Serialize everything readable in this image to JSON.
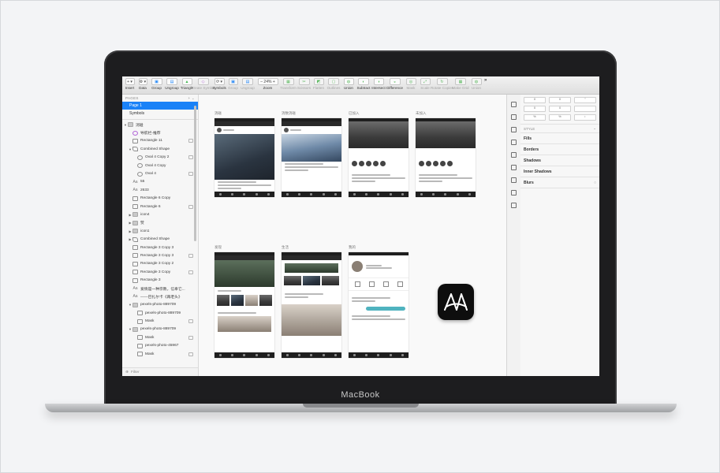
{
  "device": {
    "brand": "MacBook"
  },
  "toolbar": {
    "items": [
      {
        "label": "Insert",
        "glyph": "+ ▾",
        "enabled": true
      },
      {
        "label": "Data",
        "glyph": "⚙ ▾",
        "enabled": true
      },
      {
        "label": "Group",
        "glyph": "▣",
        "enabled": true
      },
      {
        "label": "Ungroup",
        "glyph": "▤",
        "enabled": true
      },
      {
        "label": "Triangle",
        "glyph": "▲",
        "enabled": true
      },
      {
        "label": "Create Symbol",
        "glyph": "◇",
        "enabled": false
      },
      {
        "label": "Symbols",
        "glyph": "⟳ ▾",
        "enabled": true
      },
      {
        "label": "Group",
        "glyph": "▣",
        "enabled": false
      },
      {
        "label": "Ungroup",
        "glyph": "▤",
        "enabled": false
      },
      {
        "label": "Zoom",
        "glyph": "– 24% +",
        "enabled": true
      },
      {
        "label": "Transform",
        "glyph": "▦",
        "enabled": false
      },
      {
        "label": "Scissors",
        "glyph": "✂",
        "enabled": false
      },
      {
        "label": "Flatten",
        "glyph": "◩",
        "enabled": false
      },
      {
        "label": "Outlines",
        "glyph": "▢",
        "enabled": false
      },
      {
        "label": "Union",
        "glyph": "◍",
        "enabled": true
      },
      {
        "label": "Subtract",
        "glyph": "◐",
        "enabled": true
      },
      {
        "label": "Intersect",
        "glyph": "◑",
        "enabled": true
      },
      {
        "label": "Difference",
        "glyph": "◒",
        "enabled": true
      },
      {
        "label": "Mask",
        "glyph": "◎",
        "enabled": false
      },
      {
        "label": "Scale",
        "glyph": "⤢",
        "enabled": false
      },
      {
        "label": "Rotate Copies",
        "glyph": "↻",
        "enabled": false
      },
      {
        "label": "Make Grid",
        "glyph": "▦",
        "enabled": false
      },
      {
        "label": "Union",
        "glyph": "◍",
        "enabled": false
      }
    ],
    "overflow": "»"
  },
  "sidebar": {
    "pages_header": "PAGES",
    "pages_add": "+ ⌄",
    "pages": [
      "Page 1",
      "Symbols"
    ],
    "layers": [
      {
        "name": "消碰",
        "indent": 0,
        "arrow": "▼",
        "type": "folder"
      },
      {
        "name": "导航栏-推荐",
        "indent": 1,
        "arrow": "",
        "type": "symbol"
      },
      {
        "name": "Rectangle 11",
        "indent": 1,
        "arrow": "",
        "type": "rect"
      },
      {
        "name": "Combined Shape",
        "indent": 1,
        "arrow": "▼",
        "type": "shape"
      },
      {
        "name": "Oval 4 Copy 2",
        "indent": 2,
        "arrow": "",
        "type": "oval"
      },
      {
        "name": "Oval 4 Copy",
        "indent": 2,
        "arrow": "",
        "type": "oval"
      },
      {
        "name": "Oval 4",
        "indent": 2,
        "arrow": "",
        "type": "oval"
      },
      {
        "name": "55",
        "indent": 1,
        "arrow": "",
        "type": "text"
      },
      {
        "name": "2633",
        "indent": 1,
        "arrow": "",
        "type": "text"
      },
      {
        "name": "Rectangle 6 Copy",
        "indent": 1,
        "arrow": "",
        "type": "rect"
      },
      {
        "name": "Rectangle 6",
        "indent": 1,
        "arrow": "",
        "type": "rect"
      },
      {
        "name": "icon4",
        "indent": 1,
        "arrow": "▶",
        "type": "folder"
      },
      {
        "name": "赞",
        "indent": 1,
        "arrow": "▶",
        "type": "folder"
      },
      {
        "name": "icon1",
        "indent": 1,
        "arrow": "▶",
        "type": "folder"
      },
      {
        "name": "Combined Shape",
        "indent": 1,
        "arrow": "▶",
        "type": "shape"
      },
      {
        "name": "Rectangle 3 Copy 3",
        "indent": 1,
        "arrow": "",
        "type": "rect"
      },
      {
        "name": "Rectangle 3 Copy 3",
        "indent": 1,
        "arrow": "",
        "type": "rect"
      },
      {
        "name": "Rectangle 3 Copy 2",
        "indent": 1,
        "arrow": "",
        "type": "rect"
      },
      {
        "name": "Rectangle 3 Copy",
        "indent": 1,
        "arrow": "",
        "type": "rect"
      },
      {
        "name": "Rectangle 3",
        "indent": 1,
        "arrow": "",
        "type": "rect"
      },
      {
        "name": "爱情是一种宗教，信奉它...",
        "indent": 1,
        "arrow": "",
        "type": "text"
      },
      {
        "name": "——巴扎尔卡《再老头》",
        "indent": 1,
        "arrow": "",
        "type": "text"
      },
      {
        "name": "pexels-photo-889709",
        "indent": 1,
        "arrow": "▼",
        "type": "folder"
      },
      {
        "name": "pexels-photo-889709",
        "indent": 2,
        "arrow": "",
        "type": "image"
      },
      {
        "name": "Mask",
        "indent": 2,
        "arrow": "",
        "type": "rect"
      },
      {
        "name": "pexels-photo-889709",
        "indent": 1,
        "arrow": "▼",
        "type": "folder"
      },
      {
        "name": "Mask",
        "indent": 2,
        "arrow": "",
        "type": "rect"
      },
      {
        "name": "pexels-photo-45967",
        "indent": 2,
        "arrow": "",
        "type": "image"
      },
      {
        "name": "Mask",
        "indent": 2,
        "arrow": "",
        "type": "rect"
      }
    ],
    "filter_placeholder": "Filter"
  },
  "canvas": {
    "artboards": [
      {
        "label": "消碰",
        "variant": "feed"
      },
      {
        "label": "消数消碰",
        "variant": "feed2"
      },
      {
        "label": "已加入",
        "variant": "group"
      },
      {
        "label": "未加入",
        "variant": "group"
      },
      {
        "label": "发现",
        "variant": "discover"
      },
      {
        "label": "生活",
        "variant": "life"
      },
      {
        "label": "我的",
        "variant": "profile"
      }
    ]
  },
  "inspector": {
    "style_header": "STYLE",
    "sections": [
      "Fills",
      "Borders",
      "Shadows",
      "Inner Shadows",
      "Blurs"
    ],
    "fields": [
      [
        "0",
        "0",
        "°"
      ],
      [
        "0",
        "0",
        ""
      ],
      [
        "%",
        "%",
        "↕"
      ]
    ]
  },
  "colors": {
    "selection": "#1a82f7",
    "accent": "#4fb3bf",
    "bezel": "#1d1d1f"
  }
}
